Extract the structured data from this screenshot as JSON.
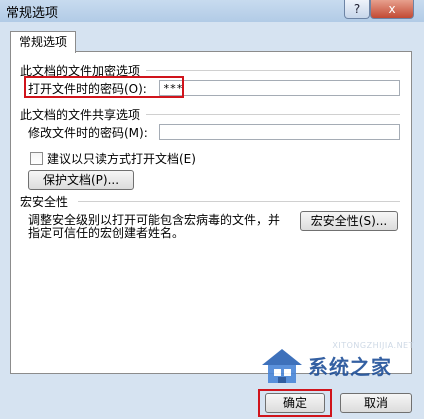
{
  "window": {
    "title": "常规选项",
    "help_glyph": "?",
    "close_glyph": "x"
  },
  "tab": {
    "label": "常规选项"
  },
  "encryption": {
    "group_title": "此文档的文件加密选项",
    "password_label": "打开文件时的密码(O):",
    "password_value": "***"
  },
  "sharing": {
    "group_title": "此文档的文件共享选项",
    "modify_password_label": "修改文件时的密码(M):",
    "modify_password_value": "",
    "readonly_label": "建议以只读方式打开文档(E)",
    "readonly_checked": false,
    "protect_button": "保护文档(P)..."
  },
  "macro": {
    "group_title": "宏安全性",
    "description_line1": "调整安全级别以打开可能包含宏病毒的文件，并",
    "description_line2": "指定可信任的宏创建者姓名。",
    "security_button": "宏安全性(S)..."
  },
  "footer": {
    "ok_button": "确定",
    "cancel_button": "取消"
  },
  "watermark": {
    "url": "XITONGZHIJIA.NET",
    "text": "系统之家"
  },
  "highlight_color": "#d0141c"
}
